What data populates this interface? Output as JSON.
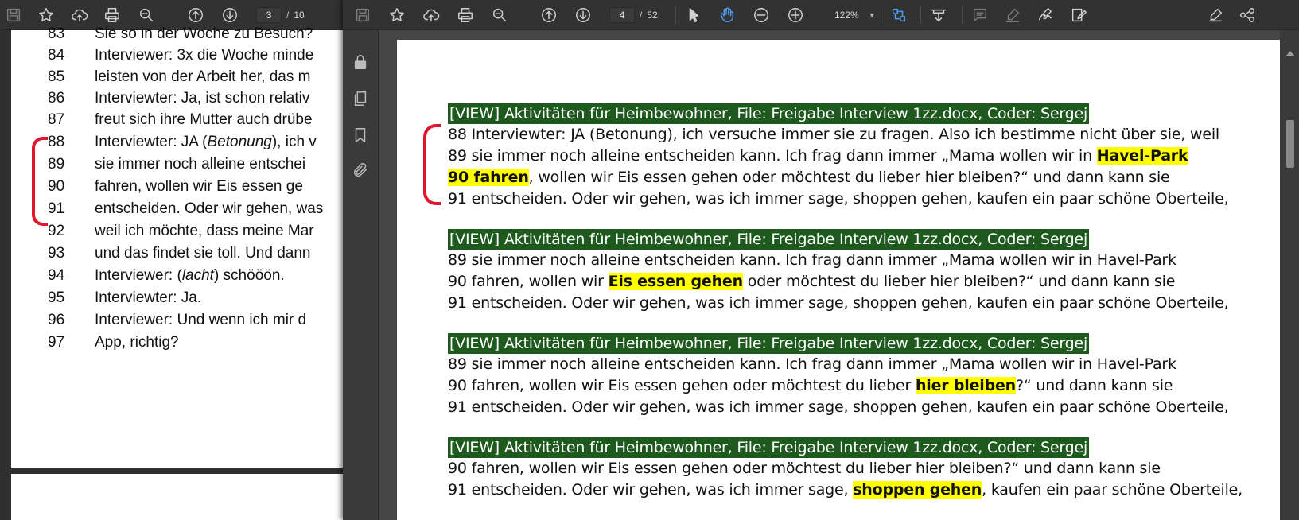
{
  "left_viewer": {
    "page_current": "3",
    "page_total": "10",
    "lines": [
      {
        "num": "83",
        "text": "Sie so in der Woche zu Besuch?"
      },
      {
        "num": "84",
        "text": "Interviewer: 3x die Woche minde"
      },
      {
        "num": "85",
        "text": "leisten von der Arbeit her, das m"
      },
      {
        "num": "86",
        "text": "Interviewter: Ja, ist schon relativ"
      },
      {
        "num": "87",
        "text": "freut sich ihre Mutter auch drübe"
      },
      {
        "num": "88",
        "text_pre": "Interviewter: JA (",
        "text_italic": "Betonung",
        "text_post": "), ich v"
      },
      {
        "num": "89",
        "text": "sie immer noch alleine entschei"
      },
      {
        "num": "90",
        "text": "fahren, wollen wir Eis essen ge"
      },
      {
        "num": "91",
        "text": "entscheiden. Oder wir gehen, was"
      },
      {
        "num": "92",
        "text": "weil ich möchte, dass meine Mar"
      },
      {
        "num": "93",
        "text": "und das findet sie toll. Und dann"
      },
      {
        "num": "94",
        "text_pre": "Interviewer: (",
        "text_italic": "lacht",
        "text_post": ") schööön."
      },
      {
        "num": "95",
        "text": "Interviewter: Ja."
      },
      {
        "num": "96",
        "text": "Interviewer: Und wenn ich mir d"
      },
      {
        "num": "97",
        "text": "App, richtig?"
      }
    ]
  },
  "right_viewer": {
    "page_current": "4",
    "page_total": "52",
    "zoom": "122%",
    "header": "[VIEW] Aktivitäten für Heimbewohner, File: Freigabe Interview 1zz.docx, Coder: Sergej",
    "block1": {
      "l1": "88 Interviewter: JA (Betonung), ich versuche immer sie zu fragen. Also ich bestimme nicht über sie, weil",
      "l2_pre": "89 sie immer noch alleine entscheiden kann. Ich frag dann immer „Mama wollen wir in ",
      "l2_hl": "Havel-Park",
      "l3_hl": "90 fahren",
      "l3_post": ", wollen wir Eis essen gehen oder möchtest du lieber hier bleiben?“ und dann kann sie",
      "l4": "91 entscheiden. Oder wir gehen, was ich immer sage, shoppen gehen, kaufen ein paar schöne Oberteile,"
    },
    "block2": {
      "l1": "89 sie immer noch alleine entscheiden kann. Ich frag dann immer „Mama wollen wir in Havel-Park",
      "l2_pre": "90 fahren, wollen wir ",
      "l2_hl": "Eis essen gehen",
      "l2_post": " oder möchtest du lieber hier bleiben?“ und dann kann sie",
      "l3": "91 entscheiden. Oder wir gehen, was ich immer sage, shoppen gehen, kaufen ein paar schöne Oberteile,"
    },
    "block3": {
      "l1": "89 sie immer noch alleine entscheiden kann. Ich frag dann immer „Mama wollen wir in Havel-Park",
      "l2_pre": "90 fahren, wollen wir Eis essen gehen oder möchtest du lieber ",
      "l2_hl": "hier bleiben",
      "l2_post": "?“ und dann kann sie",
      "l3": "91 entscheiden. Oder wir gehen, was ich immer sage, shoppen gehen, kaufen ein paar schöne Oberteile,"
    },
    "block4": {
      "l1": "90 fahren, wollen wir Eis essen gehen oder möchtest du lieber hier bleiben?“ und dann kann sie",
      "l2_pre": "91 entscheiden. Oder wir gehen, was ich immer sage, ",
      "l2_hl": "shoppen gehen",
      "l2_post": ", kaufen ein paar schöne Oberteile,"
    }
  },
  "colors": {
    "header_bg": "#1e5a1e",
    "highlight": "#ffff00",
    "annotation_red": "#e0142b",
    "toolbar_bg": "#323232"
  }
}
